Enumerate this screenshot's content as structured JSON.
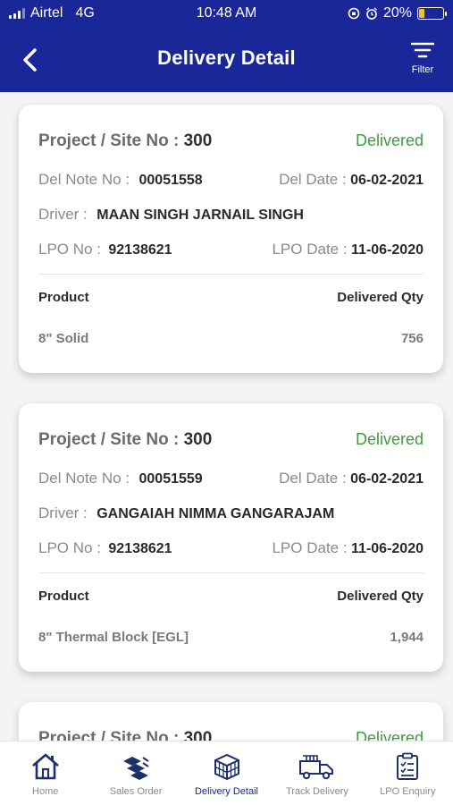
{
  "status_bar": {
    "carrier": "Airtel",
    "network": "4G",
    "time": "10:48 AM",
    "battery": "20%"
  },
  "header": {
    "title": "Delivery Detail",
    "filter_label": "Filter"
  },
  "labels": {
    "project": "Project / Site No :",
    "del_note": "Del Note No :",
    "del_date": "Del Date :",
    "driver": "Driver :",
    "lpo_no": "LPO No :",
    "lpo_date": "LPO Date :",
    "product": "Product",
    "delivered_qty": "Delivered Qty"
  },
  "deliveries": [
    {
      "project": "300",
      "status": "Delivered",
      "del_note": "00051558",
      "del_date": "06-02-2021",
      "driver": "MAAN SINGH JARNAIL SINGH",
      "lpo_no": "92138621",
      "lpo_date": "11-06-2020",
      "product": "8\" Solid",
      "qty": "756"
    },
    {
      "project": "300",
      "status": "Delivered",
      "del_note": "00051559",
      "del_date": "06-02-2021",
      "driver": "GANGAIAH NIMMA GANGARAJAM",
      "lpo_no": "92138621",
      "lpo_date": "11-06-2020",
      "product": "8\" Thermal Block [EGL]",
      "qty": "1,944"
    },
    {
      "project": "300",
      "status": "Delivered"
    }
  ],
  "tabs": [
    {
      "label": "Home",
      "icon": "home-icon"
    },
    {
      "label": "Sales Order",
      "icon": "sales-order-icon"
    },
    {
      "label": "Delivery Detail",
      "icon": "delivery-detail-icon",
      "active": true
    },
    {
      "label": "Track Delivery",
      "icon": "track-delivery-icon"
    },
    {
      "label": "LPO Enquiry",
      "icon": "lpo-enquiry-icon"
    }
  ],
  "colors": {
    "header_bg": "#1a2798",
    "status_green": "#3f9a3d",
    "active_tab": "#1a2798"
  }
}
